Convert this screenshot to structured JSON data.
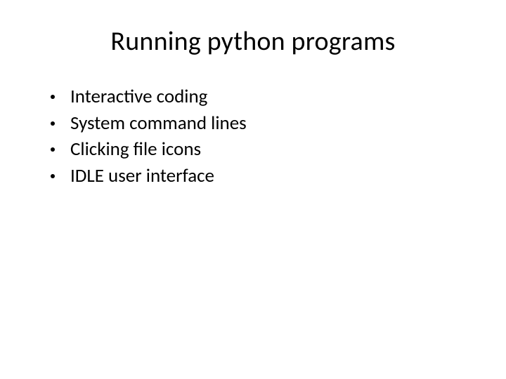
{
  "slide": {
    "title": "Running python programs",
    "bullets": [
      {
        "text": "Interactive coding"
      },
      {
        "text": "System command lines"
      },
      {
        "text": "Clicking file icons"
      },
      {
        "text": "IDLE user interface"
      }
    ]
  }
}
